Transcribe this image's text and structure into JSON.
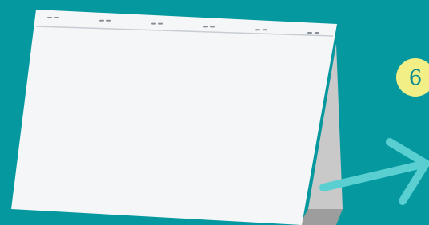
{
  "background_color": "#05989f",
  "calendar": {
    "page_color": "#f4f6f8",
    "stand_color": "#c9c9c9",
    "stand_shadow_color": "#9d9d9d",
    "ring_color": "#8a8f96",
    "binding_line_color": "#c7cdd3",
    "ring_count": 6,
    "page_content": ""
  },
  "badge": {
    "number": "6",
    "fill_color": "#f2ef86",
    "text_color": "#0b8a8f"
  },
  "arrow": {
    "color": "#59cfd1",
    "direction": "right",
    "icon": "arrow-right-icon"
  }
}
